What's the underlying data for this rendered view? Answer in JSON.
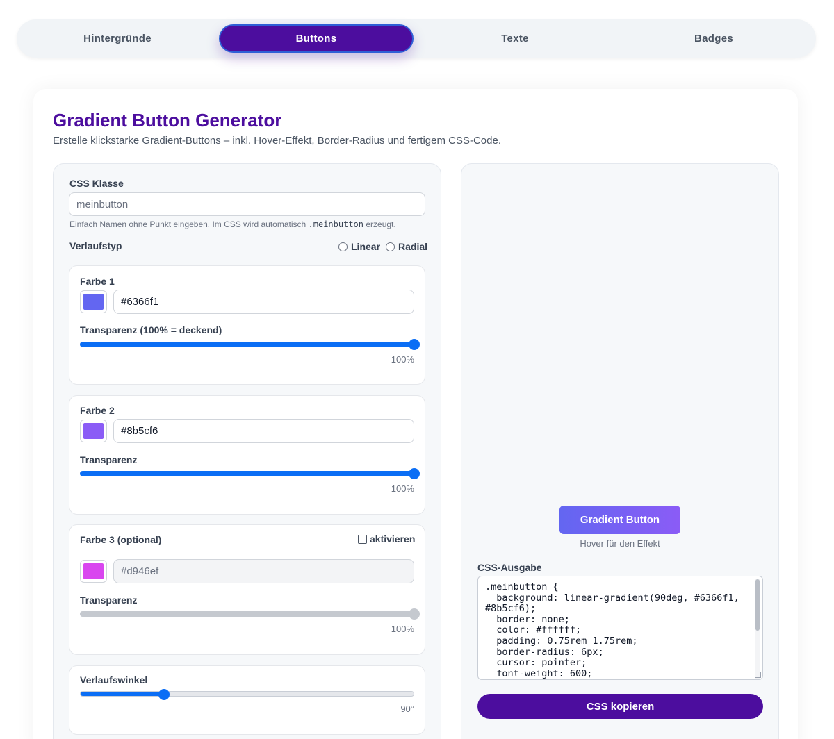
{
  "tabs": [
    {
      "label": "Hintergründe",
      "active": false
    },
    {
      "label": "Buttons",
      "active": true
    },
    {
      "label": "Texte",
      "active": false
    },
    {
      "label": "Badges",
      "active": false
    }
  ],
  "header": {
    "title": "Gradient Button Generator",
    "subtitle": "Erstelle klickstarke Gradient-Buttons – inkl. Hover-Effekt, Border-Radius und fertigem CSS-Code."
  },
  "css_class": {
    "label": "CSS Klasse",
    "placeholder": "meinbutton",
    "hint_before": "Einfach Namen ohne Punkt eingeben. Im CSS wird automatisch",
    "hint_code": ".meinbutton",
    "hint_after": "erzeugt."
  },
  "gradient_type": {
    "label": "Verlaufstyp",
    "options": [
      "Linear",
      "Radial"
    ]
  },
  "color1": {
    "label": "Farbe 1",
    "value": "#6366f1",
    "transparency_label": "Transparenz (100% = deckend)",
    "transparency_value": "100%",
    "transparency": 1.0
  },
  "color2": {
    "label": "Farbe 2",
    "value": "#8b5cf6",
    "transparency_label": "Transparenz",
    "transparency_value": "100%",
    "transparency": 1.0
  },
  "color3": {
    "label": "Farbe 3 (optional)",
    "activate_label": "aktivieren",
    "placeholder": "#d946ef",
    "swatch_color": "#d946ef",
    "transparency_label": "Transparenz",
    "transparency_value": "100%",
    "transparency": 1.0
  },
  "angle": {
    "label": "Verlaufswinkel",
    "value": "90°",
    "fraction": 0.25
  },
  "preview": {
    "button_label": "Gradient Button",
    "hint": "Hover für den Effekt"
  },
  "output": {
    "label": "CSS-Ausgabe",
    "code": ".meinbutton {\n  background: linear-gradient(90deg, #6366f1, #8b5cf6);\n  border: none;\n  color: #ffffff;\n  padding: 0.75rem 1.75rem;\n  border-radius: 6px;\n  cursor: pointer;\n  font-weight: 600;",
    "copy_label": "CSS kopieren"
  },
  "colors": {
    "accent": "#4c0d9e",
    "slider": "#0b6ef5"
  }
}
